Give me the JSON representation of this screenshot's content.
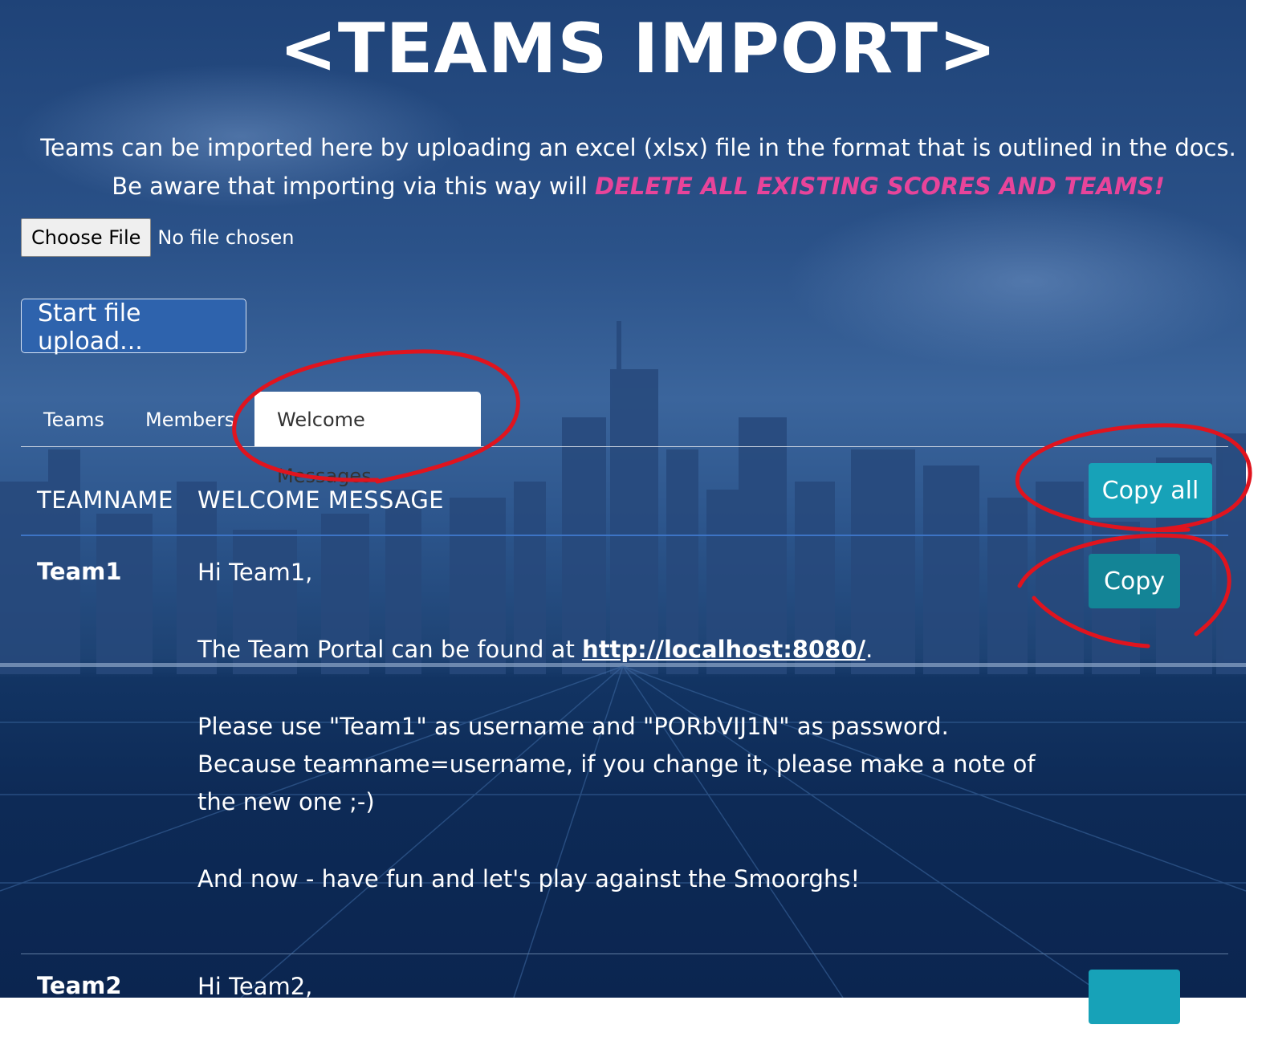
{
  "title": "<TEAMS IMPORT>",
  "intro": {
    "text": "Teams can be imported here by uploading an excel (xlsx) file in the format that is outlined in the docs. Be aware that importing via this way will ",
    "warning": "DELETE ALL EXISTING SCORES AND TEAMS!"
  },
  "file_input": {
    "button_label": "Choose File",
    "status": "No file chosen"
  },
  "upload_button": "Start file upload...",
  "tabs": [
    {
      "label": "Teams",
      "active": false
    },
    {
      "label": "Members",
      "active": false
    },
    {
      "label": "Welcome Messages",
      "active": true
    }
  ],
  "table": {
    "headers": [
      "TEAMNAME",
      "WELCOME MESSAGE"
    ],
    "copy_all_label": "Copy all",
    "rows": [
      {
        "team": "Team1",
        "copy_label": "Copy",
        "greeting": "Hi Team1,",
        "portal_prefix": "The Team Portal can be found at ",
        "portal_link": "http://localhost:8080/",
        "portal_suffix": ".",
        "credentials": "Please use \"Team1\" as username and \"PORbVIJ1N\" as password. Because teamname=username, if you change it, please make a note of the new one ;-)",
        "closing": "And now - have fun and let's play against the Smoorghs!"
      },
      {
        "team": "Team2",
        "greeting": "Hi Team2,"
      }
    ]
  },
  "colors": {
    "warning": "#e8449a",
    "primary_button": "#2e63ad",
    "teal_button": "#17a2b8",
    "annotation": "#e0141e"
  }
}
